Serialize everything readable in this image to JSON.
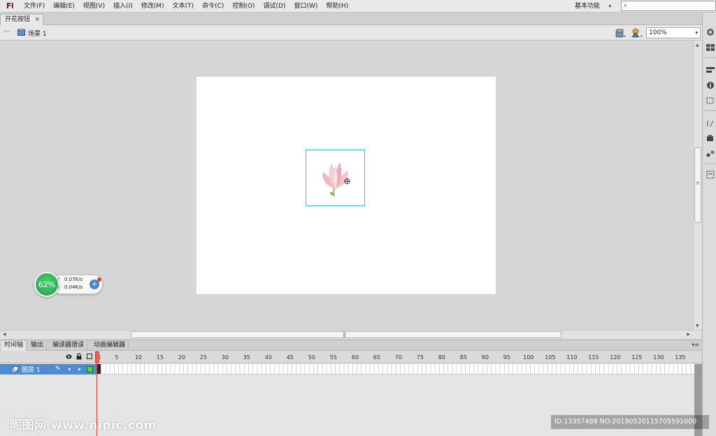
{
  "app": {
    "logo": "Fl",
    "menu": [
      {
        "label": "文件(F)"
      },
      {
        "label": "编辑(E)"
      },
      {
        "label": "视图(V)"
      },
      {
        "label": "插入(I)"
      },
      {
        "label": "修改(M)"
      },
      {
        "label": "文本(T)"
      },
      {
        "label": "命令(C)"
      },
      {
        "label": "控制(O)"
      },
      {
        "label": "调试(D)"
      },
      {
        "label": "窗口(W)"
      },
      {
        "label": "帮助(H)"
      }
    ],
    "workspace": "基本功能",
    "search_placeholder": ""
  },
  "document": {
    "tab_title": "开花按钮",
    "tab_close": "×"
  },
  "editbar": {
    "scene": "场景 1",
    "zoom": "100%"
  },
  "stage": {
    "background": "#ffffff",
    "symbol": "flower-button",
    "selection_color": "#41b8e0"
  },
  "network_widget": {
    "percent": "62%",
    "upload": "0.07K/s",
    "download": "0.04K/s",
    "plus": "+"
  },
  "panel_tabs": [
    {
      "label": "时间轴",
      "active": true
    },
    {
      "label": "输出",
      "active": false
    },
    {
      "label": "编译器错误",
      "active": false
    },
    {
      "label": "动画编辑器",
      "active": false
    }
  ],
  "timeline": {
    "frame_numbers": [
      1,
      5,
      10,
      15,
      20,
      25,
      30,
      35,
      40,
      45,
      50,
      55,
      60,
      65,
      70,
      75,
      80,
      85,
      90,
      95,
      100,
      105,
      110,
      115,
      120,
      125,
      130,
      135
    ],
    "current_frame": 1,
    "layers": [
      {
        "name": "图层 1",
        "color": "#4ad44a",
        "selected": true
      }
    ]
  },
  "watermarks": {
    "site": "昵图网 www.nipic.com",
    "id": "ID:13357488 NO:20190520115705591000"
  }
}
